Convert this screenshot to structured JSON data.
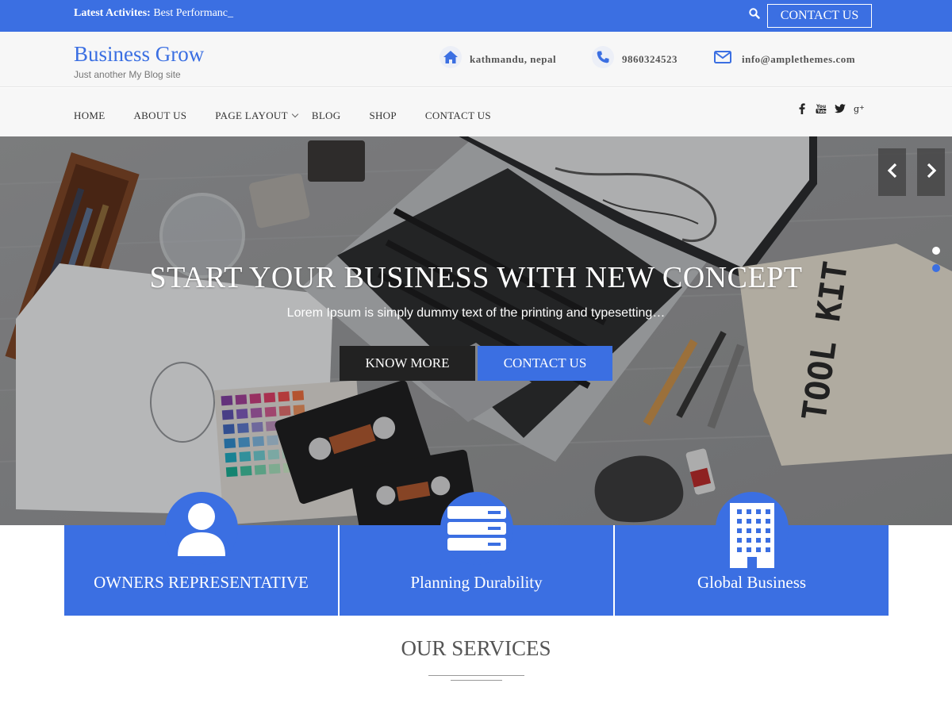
{
  "topbar": {
    "latest_label": "Latest Activites:",
    "latest_text": "Best Performanc_",
    "contact_button": "CONTACT US",
    "search_icon": "search-icon"
  },
  "header": {
    "brand": "Business Grow",
    "tagline": "Just another My Blog site",
    "address": "kathmandu, nepal",
    "phone": "9860324523",
    "email": "info@amplethemes.com"
  },
  "nav": {
    "items": [
      "HOME",
      "ABOUT US",
      "PAGE LAYOUT",
      "BLOG",
      "SHOP",
      "CONTACT US"
    ],
    "social": [
      "facebook-icon",
      "youtube-icon",
      "twitter-icon",
      "google-plus-icon"
    ]
  },
  "hero": {
    "title": "START YOUR BUSINESS WITH NEW CONCEPT",
    "subtitle": "Lorem Ipsum is simply dummy text of the printing and typesetting…",
    "know_more": "KNOW MORE",
    "contact": "CONTACT US",
    "slides": 2,
    "active_slide": 2
  },
  "features": [
    {
      "label": "OWNERS REPRESENTATIVE",
      "icon": "user-icon"
    },
    {
      "label": "Planning Durability",
      "icon": "server-icon"
    },
    {
      "label": "Global Business",
      "icon": "building-icon"
    }
  ],
  "services": {
    "heading": "OUR SERVICES"
  },
  "colors": {
    "accent": "#3b6fe2",
    "dark_button": "#222222",
    "header_bg": "#f7f7f7"
  }
}
